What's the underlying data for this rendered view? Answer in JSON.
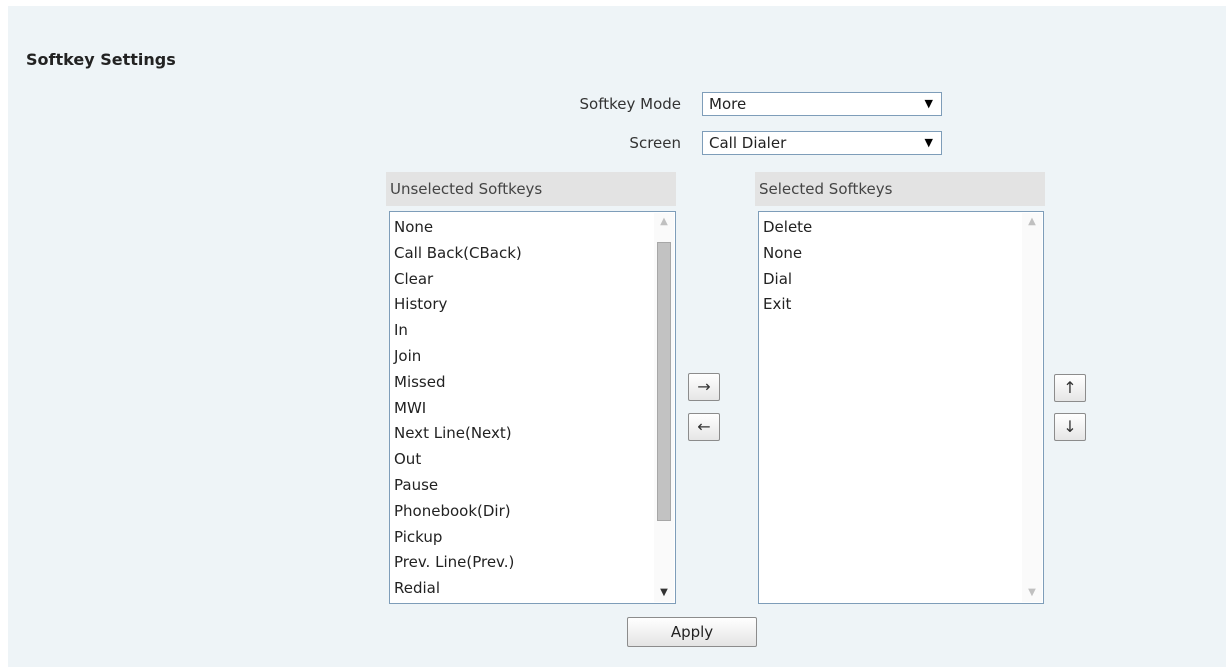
{
  "section": {
    "title": "Softkey Settings"
  },
  "fields": {
    "mode": {
      "label": "Softkey Mode",
      "value": "More"
    },
    "screen": {
      "label": "Screen",
      "value": "Call Dialer"
    }
  },
  "unselected": {
    "header": "Unselected Softkeys",
    "items": [
      "None",
      "Call Back(CBack)",
      "Clear",
      "History",
      "In",
      "Join",
      "Missed",
      "MWI",
      "Next Line(Next)",
      "Out",
      "Pause",
      "Phonebook(Dir)",
      "Pickup",
      "Prev. Line(Prev.)",
      "Redial"
    ]
  },
  "selected": {
    "header": "Selected Softkeys",
    "items": [
      "Delete",
      "None",
      "Dial",
      "Exit"
    ]
  },
  "buttons": {
    "move_right": "→",
    "move_left": "←",
    "move_up": "↑",
    "move_down": "↓",
    "apply": "Apply"
  },
  "icons": {
    "dropdown": "▼",
    "scroll_up": "▲",
    "scroll_down": "▼"
  }
}
